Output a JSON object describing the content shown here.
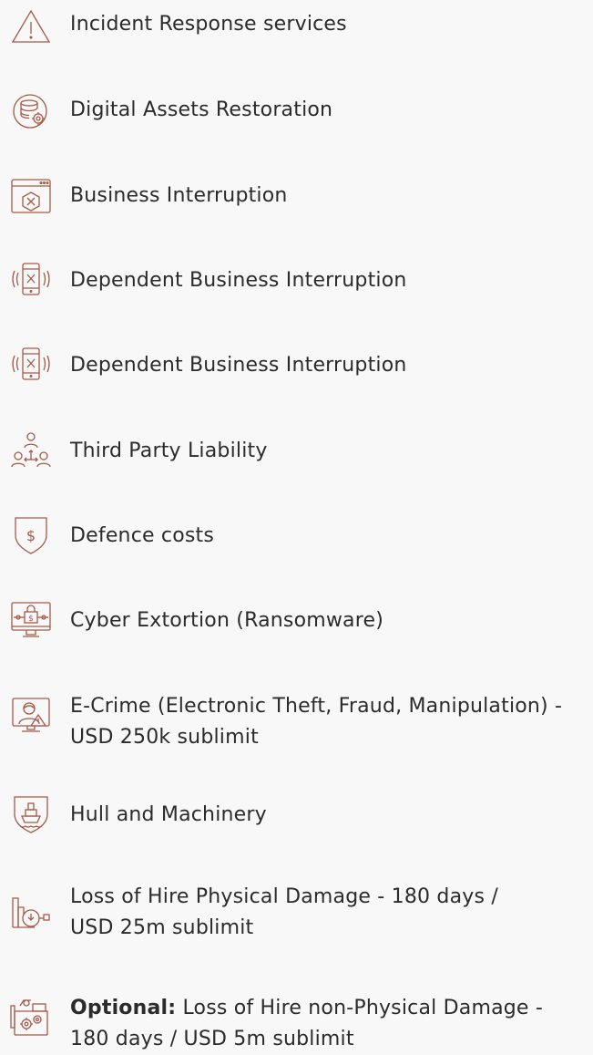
{
  "accent_color": "#a65a48",
  "items": [
    {
      "icon": "warning-triangle-icon",
      "text": "Incident Response services"
    },
    {
      "icon": "database-gear-icon",
      "text": "Digital Assets Restoration"
    },
    {
      "icon": "browser-error-icon",
      "text": "Business Interruption"
    },
    {
      "icon": "phone-vibrate-x-icon",
      "text": "Dependent Business Interruption"
    },
    {
      "icon": "phone-vibrate-x-icon",
      "text": "Dependent Business Interruption"
    },
    {
      "icon": "people-network-icon",
      "text": "Third Party Liability"
    },
    {
      "icon": "shield-dollar-icon",
      "text": "Defence costs"
    },
    {
      "icon": "monitor-dollar-lock-icon",
      "text": "Cyber Extortion (Ransomware)"
    },
    {
      "icon": "hacker-monitor-icon",
      "line1": "E-Crime (Electronic Theft, Fraud, Manipulation) -",
      "line2": "USD 250k sublimit"
    },
    {
      "icon": "shield-ship-icon",
      "text": "Hull and Machinery"
    },
    {
      "icon": "factory-clock-icon",
      "line1": "Loss of Hire Physical Damage - 180 days /",
      "line2": "USD 25m sublimit"
    },
    {
      "icon": "machine-gears-icon",
      "label": "Optional:",
      "line1_rest": " Loss of Hire non-Physical Damage -",
      "line2": "180 days / USD 5m sublimit"
    }
  ]
}
